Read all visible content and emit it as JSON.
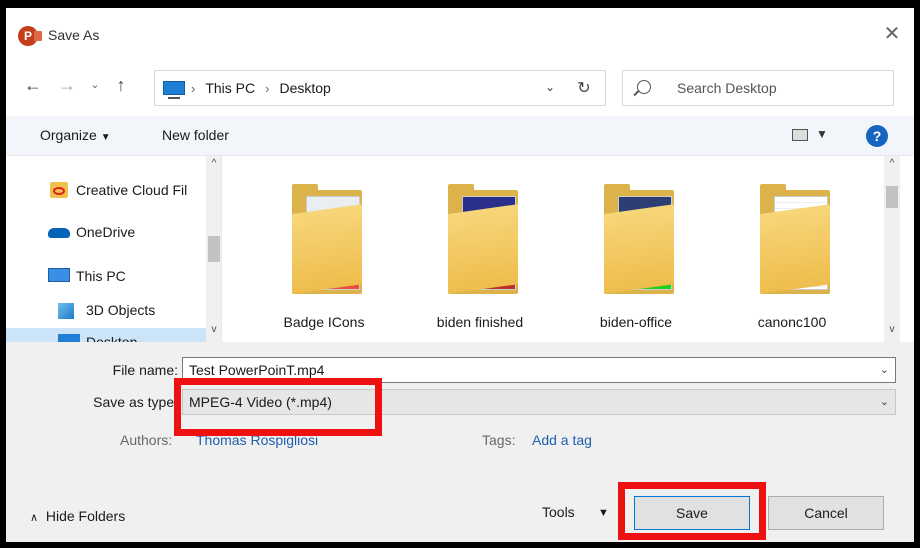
{
  "window": {
    "title": "Save As",
    "app_icon_letter": "P"
  },
  "address": {
    "crumbs": [
      "This PC",
      "Desktop"
    ],
    "search_placeholder": "Search Desktop"
  },
  "toolbar": {
    "organize": "Organize",
    "new_folder": "New folder"
  },
  "nav_pane": {
    "items": [
      {
        "label": "Creative Cloud Fil",
        "icon": "creative-cloud-icon"
      },
      {
        "label": "OneDrive",
        "icon": "onedrive-icon"
      },
      {
        "label": "This PC",
        "icon": "pc-icon"
      },
      {
        "label": "3D Objects",
        "icon": "cube-icon"
      },
      {
        "label": "Desktop",
        "icon": "desktop-icon"
      }
    ]
  },
  "folders": [
    {
      "name": "Badge ICons"
    },
    {
      "name": "biden finished"
    },
    {
      "name": "biden-office"
    },
    {
      "name": "canonc100"
    }
  ],
  "form": {
    "file_name_label": "File name:",
    "file_name_value": "Test PowerPoinT.mp4",
    "save_as_type_label": "Save as type:",
    "save_as_type_value": "MPEG-4 Video (*.mp4)",
    "authors_label": "Authors:",
    "authors_value": "Thomas Rospigliosi",
    "tags_label": "Tags:",
    "tags_value": "Add a tag"
  },
  "footer": {
    "hide_folders": "Hide Folders",
    "tools": "Tools",
    "save": "Save",
    "cancel": "Cancel"
  },
  "colors": {
    "highlight_box": "#ee1111",
    "accent": "#0078d7",
    "selected": "#cce4f7"
  }
}
